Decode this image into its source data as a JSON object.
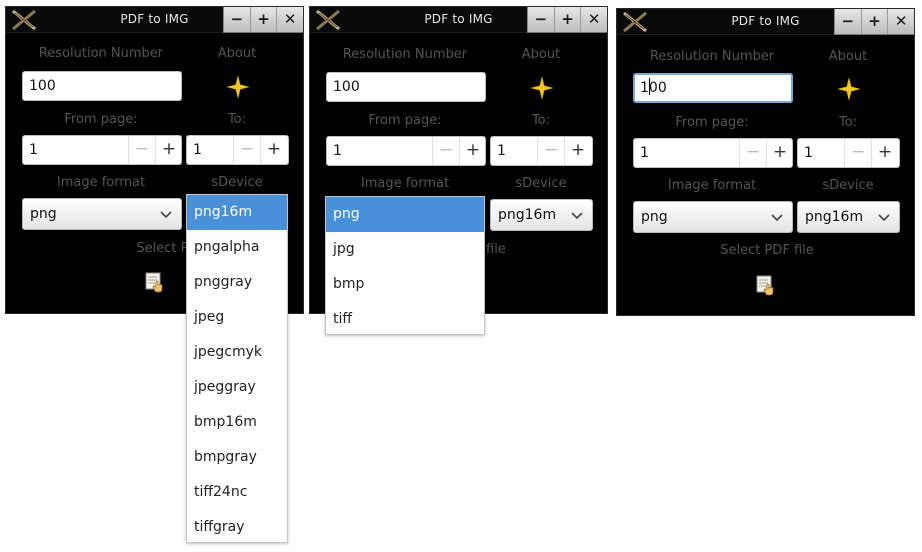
{
  "window": {
    "title": "PDF to IMG",
    "buttons": [
      "−",
      "+",
      "✕"
    ]
  },
  "form": {
    "resolution_label": "Resolution Number",
    "about_label": "About",
    "resolution_value": "100",
    "from_label": "From page:",
    "to_label": "To:",
    "from_value": "1",
    "to_value": "1",
    "image_format_label": "Image format",
    "sdevice_label": "sDevice",
    "image_format_value": "png",
    "sdevice_value": "png16m",
    "select_pdf_label": "Select PDF file",
    "select_pdf_partial": "Select PDF",
    "select_pdf_tail": "file"
  },
  "sdevice_options": [
    "png16m",
    "pngalpha",
    "pnggray",
    "jpeg",
    "jpegcmyk",
    "jpeggray",
    "bmp16m",
    "bmpgray",
    "tiff24nc",
    "tiffgray"
  ],
  "image_format_options": [
    "png",
    "jpg",
    "bmp",
    "tiff"
  ],
  "colors": {
    "window_bg": "#000000",
    "selection": "#4a90d9",
    "star": "#f3c623",
    "label": "#555555"
  },
  "icons": [
    "x-app-icon",
    "star-icon",
    "pdf-hand-icon",
    "chevron-down-icon"
  ]
}
